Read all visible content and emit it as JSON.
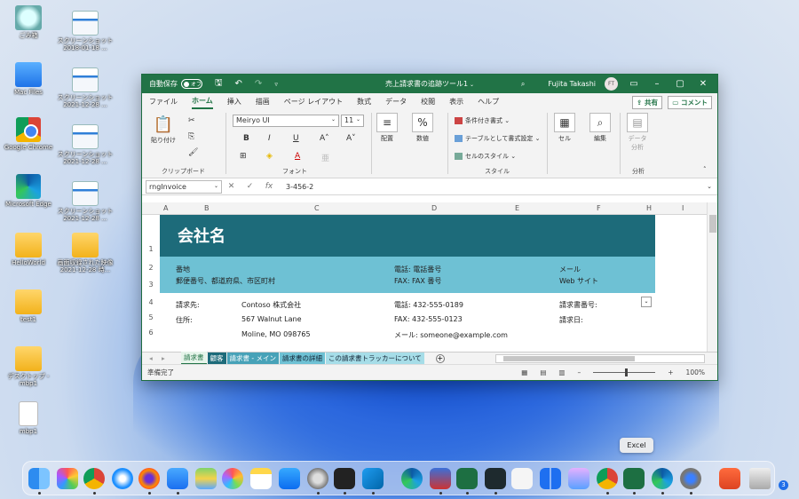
{
  "desktop": {
    "icons": [
      {
        "label": "ごみ箱",
        "kind": "recycle"
      },
      {
        "label": "スクリーンショット 2018-01-18 ...",
        "kind": "shot"
      },
      {
        "label": "Mac Files",
        "kind": "macfiles"
      },
      {
        "label": "スクリーンショット 2021-12-28 ...",
        "kind": "shot"
      },
      {
        "label": "Google Chrome",
        "kind": "chrome"
      },
      {
        "label": "スクリーンショット 2021-12-28 ...",
        "kind": "shot"
      },
      {
        "label": "Microsoft Edge",
        "kind": "edge"
      },
      {
        "label": "スクリーンショット 2021-12-28 ...",
        "kind": "shot"
      },
      {
        "label": "HelloWorld",
        "kind": "folder"
      },
      {
        "label": "画面収録された映像 2021-12-28 時...",
        "kind": "folder"
      },
      {
        "label": "test1",
        "kind": "folder"
      },
      {
        "label": "デスクトップ - mbp1",
        "kind": "folder"
      },
      {
        "label": "mbp1",
        "kind": "file"
      }
    ]
  },
  "window": {
    "autosave_label": "自動保存",
    "autosave_state": "オフ",
    "title": "売上請求書の追跡ツール1",
    "user_name": "Fujita Takashi",
    "user_initials": "FT"
  },
  "tabs": [
    "ファイル",
    "ホーム",
    "挿入",
    "描画",
    "ページ レイアウト",
    "数式",
    "データ",
    "校閲",
    "表示",
    "ヘルプ"
  ],
  "share_label": "共有",
  "comment_label": "コメント",
  "ribbon": {
    "paste_label": "貼り付け",
    "clipboard_label": "クリップボード",
    "font_name": "Meiryo UI",
    "font_size": "11",
    "font_label": "フォント",
    "align_label": "配置",
    "number_label": "数値",
    "conditional_label": "条件付き書式",
    "table_label": "テーブルとして書式設定",
    "cellstyle_label": "セルのスタイル",
    "style_label": "スタイル",
    "cells_label": "セル",
    "edit_label": "編集",
    "data_analysis_label": "データ分析",
    "analysis_label": "分析"
  },
  "formula": {
    "name_box": "rngInvoice",
    "value": "3-456-2"
  },
  "columns": [
    "A",
    "B",
    "C",
    "D",
    "E",
    "F",
    "H",
    "I"
  ],
  "rows": [
    "1",
    "2",
    "3",
    "4",
    "5",
    "6"
  ],
  "sheet": {
    "company": "会社名",
    "address_label": "番地",
    "address_detail": "郵便番号、都道府県、市区町村",
    "phone": "電話: 電話番号",
    "fax": "FAX: FAX 番号",
    "email": "メール",
    "website": "Web サイト",
    "bill_to": "請求先:",
    "bill_company": "Contoso 株式会社",
    "address": "住所:",
    "street": "567 Walnut Lane",
    "city": "Moline, MO 098765",
    "bill_phone": "電話: 432-555-0189",
    "bill_fax": "FAX: 432-555-0123",
    "bill_email": "メール: someone@example.com",
    "invoice_no": "請求書番号:",
    "invoice_date": "請求日:"
  },
  "sheet_tabs": [
    "請求書",
    "顧客",
    "請求書 - メイン",
    "請求書の詳細",
    "この請求書トラッカーについて"
  ],
  "status": {
    "ready": "準備完了",
    "zoom": "100%"
  },
  "tooltip": "Excel",
  "dock_badge": "3",
  "colors": {
    "excel_green": "#217346",
    "header_dark": "#1d6b7a",
    "header_light": "#6ec1d4"
  }
}
